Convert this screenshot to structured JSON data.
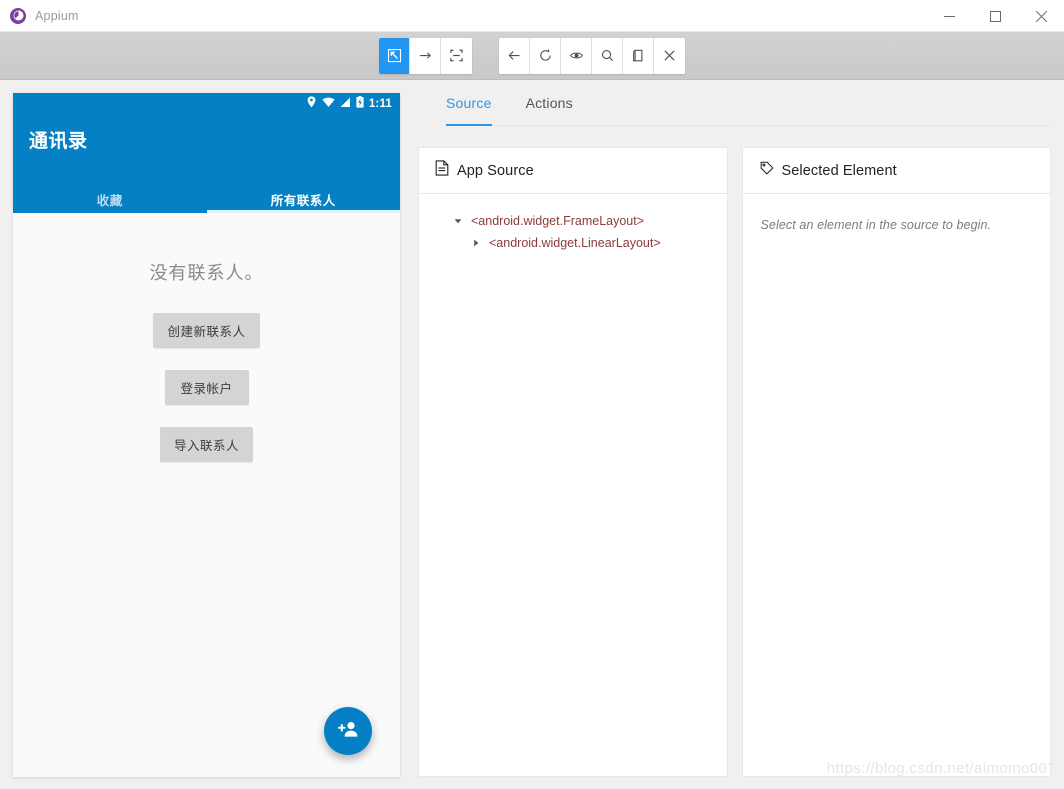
{
  "window": {
    "title": "Appium",
    "logo_icon": "appium-logo-icon",
    "minimize_label": "—",
    "maximize_label": "□",
    "close_label": "✕"
  },
  "toolbar": {
    "group_one": [
      {
        "name": "select-element-button",
        "icon": "cursor-select-icon",
        "active": true
      },
      {
        "name": "swipe-button",
        "icon": "swipe-arrow-icon",
        "active": false
      },
      {
        "name": "tap-button",
        "icon": "tap-crop-icon",
        "active": false
      }
    ],
    "group_two": [
      {
        "name": "back-button",
        "icon": "arrow-left-icon",
        "active": false
      },
      {
        "name": "refresh-button",
        "icon": "refresh-icon",
        "active": false
      },
      {
        "name": "inspect-button",
        "icon": "eye-icon",
        "active": false
      },
      {
        "name": "search-button",
        "icon": "search-icon",
        "active": false
      },
      {
        "name": "copy-button",
        "icon": "copy-icon",
        "active": false
      },
      {
        "name": "quit-session-button",
        "icon": "close-x-icon",
        "active": false
      }
    ]
  },
  "device": {
    "status_bar": {
      "time": "1:11",
      "icons": [
        "location-pin-icon",
        "wifi-icon",
        "signal-icon",
        "battery-charging-icon"
      ]
    },
    "app_bar_title": "通讯录",
    "tabs": [
      {
        "label": "收藏",
        "active": false
      },
      {
        "label": "所有联系人",
        "active": true
      }
    ],
    "empty_state": {
      "message": "没有联系人。",
      "buttons": [
        "创建新联系人",
        "登录帐户",
        "导入联系人"
      ]
    },
    "fab_icon": "add-person-icon",
    "accent_color": "#0580c4"
  },
  "inspector": {
    "tabs": [
      {
        "label": "Source",
        "active": true
      },
      {
        "label": "Actions",
        "active": false
      }
    ],
    "source_panel": {
      "icon": "document-icon",
      "title": "App Source",
      "tree": [
        {
          "label": "<android.widget.FrameLayout>",
          "level": 0,
          "expanded": true
        },
        {
          "label": "<android.widget.LinearLayout>",
          "level": 1,
          "expanded": false
        }
      ]
    },
    "selected_panel": {
      "icon": "tag-icon",
      "title": "Selected Element",
      "placeholder": "Select an element in the source to begin."
    },
    "accent_color": "#2f95e8"
  },
  "watermark": "https://blog.csdn.net/aimomo007"
}
